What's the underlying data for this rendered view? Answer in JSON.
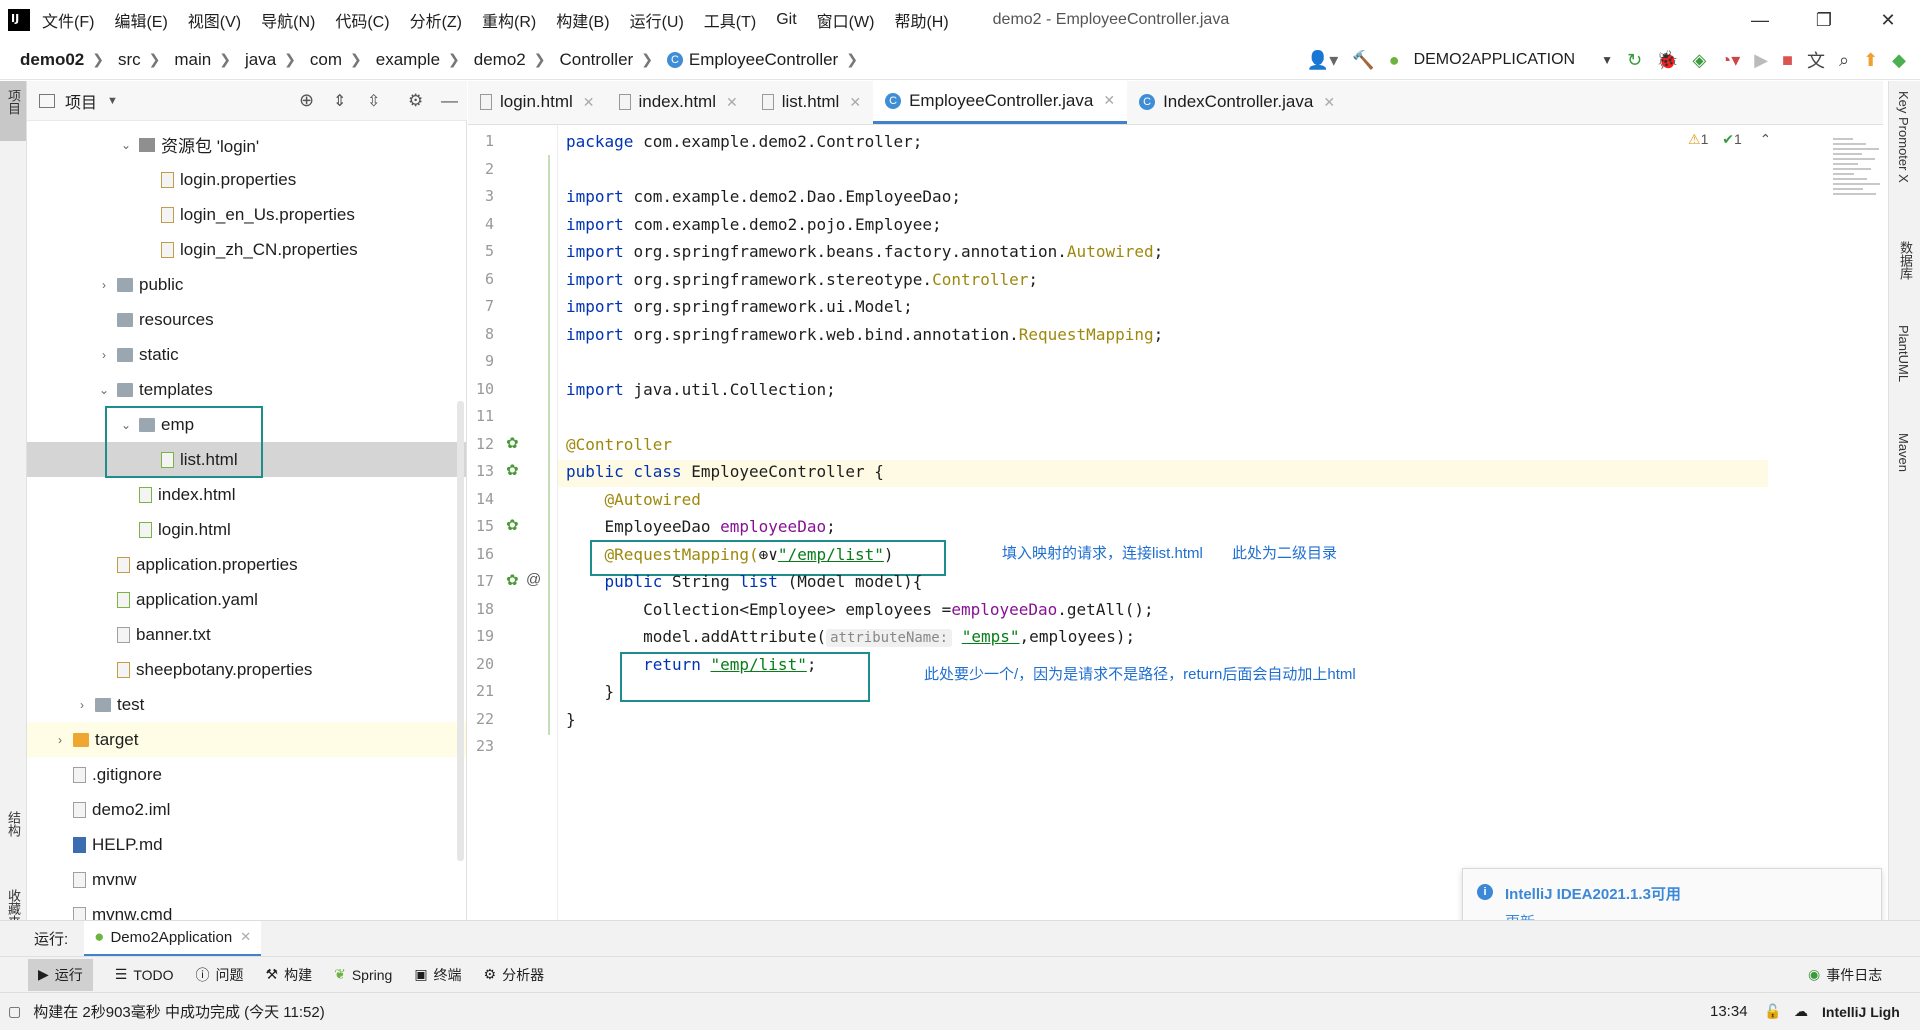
{
  "menu": {
    "items": [
      "文件(F)",
      "编辑(E)",
      "视图(V)",
      "导航(N)",
      "代码(C)",
      "分析(Z)",
      "重构(R)",
      "构建(B)",
      "运行(U)",
      "工具(T)",
      "Git",
      "窗口(W)",
      "帮助(H)"
    ],
    "window_title": "demo2 - EmployeeController.java"
  },
  "breadcrumb": [
    "demo02",
    "src",
    "main",
    "java",
    "com",
    "example",
    "demo2",
    "Controller",
    "EmployeeController"
  ],
  "run_config": "DEMO2APPLICATION",
  "project_panel": {
    "title": "项目",
    "left_tabs": [
      "项目",
      "结构",
      "收藏夹"
    ],
    "items": [
      {
        "label": "资源包 'login'",
        "depth": 2,
        "arrow": "down",
        "icon": "package"
      },
      {
        "label": "login.properties",
        "depth": 3,
        "arrow": "",
        "icon": "prop"
      },
      {
        "label": "login_en_Us.properties",
        "depth": 3,
        "arrow": "",
        "icon": "prop"
      },
      {
        "label": "login_zh_CN.properties",
        "depth": 3,
        "arrow": "",
        "icon": "prop"
      },
      {
        "label": "public",
        "depth": 1,
        "arrow": "right",
        "icon": "folder"
      },
      {
        "label": "resources",
        "depth": 1,
        "arrow": "",
        "icon": "folder"
      },
      {
        "label": "static",
        "depth": 1,
        "arrow": "right",
        "icon": "folder"
      },
      {
        "label": "templates",
        "depth": 1,
        "arrow": "down",
        "icon": "folder"
      },
      {
        "label": "emp",
        "depth": 2,
        "arrow": "down",
        "icon": "folder"
      },
      {
        "label": "list.html",
        "depth": 3,
        "arrow": "",
        "icon": "html"
      },
      {
        "label": "index.html",
        "depth": 2,
        "arrow": "",
        "icon": "html"
      },
      {
        "label": "login.html",
        "depth": 2,
        "arrow": "",
        "icon": "html"
      },
      {
        "label": "application.properties",
        "depth": 1,
        "arrow": "",
        "icon": "prop"
      },
      {
        "label": "application.yaml",
        "depth": 1,
        "arrow": "",
        "icon": "yaml"
      },
      {
        "label": "banner.txt",
        "depth": 1,
        "arrow": "",
        "icon": "txt"
      },
      {
        "label": "sheepbotany.properties",
        "depth": 1,
        "arrow": "",
        "icon": "prop"
      },
      {
        "label": "test",
        "depth": 0,
        "arrow": "right",
        "icon": "folder"
      },
      {
        "label": "target",
        "depth": -1,
        "arrow": "right",
        "icon": "folder-orange"
      },
      {
        "label": ".gitignore",
        "depth": -1,
        "arrow": "",
        "icon": "txt"
      },
      {
        "label": "demo2.iml",
        "depth": -1,
        "arrow": "",
        "icon": "txt"
      },
      {
        "label": "HELP.md",
        "depth": -1,
        "arrow": "",
        "icon": "md"
      },
      {
        "label": "mvnw",
        "depth": -1,
        "arrow": "",
        "icon": "txt"
      },
      {
        "label": "mvnw.cmd",
        "depth": -1,
        "arrow": "",
        "icon": "txt"
      }
    ]
  },
  "editor_tabs": [
    {
      "label": "login.html",
      "type": "html",
      "active": false
    },
    {
      "label": "index.html",
      "type": "html",
      "active": false
    },
    {
      "label": "list.html",
      "type": "html",
      "active": false
    },
    {
      "label": "EmployeeController.java",
      "type": "java",
      "active": true
    },
    {
      "label": "IndexController.java",
      "type": "java",
      "active": false
    }
  ],
  "inspection": {
    "warnings": "1",
    "ok": "1"
  },
  "code_lines": [
    [
      [
        "kw",
        "package"
      ],
      [
        "",
        "com.example.demo2.Controller;"
      ]
    ],
    [],
    [
      [
        "kw",
        "import"
      ],
      [
        "",
        "com.example.demo2.Dao.EmployeeDao;"
      ]
    ],
    [
      [
        "kw",
        "import"
      ],
      [
        "",
        "com.example.demo2.pojo.Employee;"
      ]
    ],
    [
      [
        "kw",
        "import"
      ],
      [
        "",
        "org.springframework.beans.factory.annotation."
      ],
      [
        "ann",
        "Autowired"
      ],
      [
        "",
        ";"
      ]
    ],
    [
      [
        "kw",
        "import"
      ],
      [
        "",
        "org.springframework.stereotype."
      ],
      [
        "ann",
        "Controller"
      ],
      [
        "",
        ";"
      ]
    ],
    [
      [
        "kw",
        "import"
      ],
      [
        "",
        "org.springframework.ui.Model;"
      ]
    ],
    [
      [
        "kw",
        "import"
      ],
      [
        "",
        "org.springframework.web.bind.annotation."
      ],
      [
        "ann",
        "RequestMapping"
      ],
      [
        "",
        ";"
      ]
    ],
    [],
    [
      [
        "kw",
        "import"
      ],
      [
        "",
        "java.util.Collection;"
      ]
    ],
    [],
    [
      [
        "ann",
        "@Controller"
      ]
    ],
    [
      [
        "kw",
        "public class"
      ],
      [
        "",
        "EmployeeController {"
      ]
    ],
    [
      [
        "ann",
        "    @Autowired"
      ]
    ],
    [
      [
        "",
        "    EmployeeDao "
      ],
      [
        "fld",
        "employeeDao"
      ],
      [
        "",
        ";"
      ]
    ],
    [
      [
        "ann",
        "    @RequestMapping("
      ],
      [
        "",
        "⊕∨"
      ],
      [
        "str",
        "\"/emp/list\""
      ],
      [
        "",
        ")"
      ]
    ],
    [
      [
        "kw",
        "    public"
      ],
      [
        "",
        "String "
      ],
      [
        "kw",
        "list"
      ],
      [
        "",
        "(Model model){"
      ]
    ],
    [
      [
        "",
        "        Collection<Employee> employees ="
      ],
      [
        "fld",
        "employeeDao"
      ],
      [
        "",
        ".getAll();"
      ]
    ],
    [
      [
        "",
        "        model.addAttribute("
      ],
      [
        "hint",
        "attributeName:"
      ],
      [
        "str",
        "\"emps\""
      ],
      [
        "",
        ",employees);"
      ]
    ],
    [
      [
        "kw",
        "        return"
      ],
      [
        "str",
        "\"emp/list\""
      ],
      [
        "",
        ";"
      ]
    ],
    [
      [
        "",
        "    }"
      ]
    ],
    [
      [
        "",
        "}"
      ]
    ],
    []
  ],
  "notes": {
    "note1": "填入映射的请求，连接list.html",
    "note2": "此处为二级目录",
    "note3": "此处要少一个/，因为是请求不是路径，return后面会自动加上html"
  },
  "right_tabs": [
    "Key Promoter X",
    "数据库",
    "PlantUML",
    "Maven"
  ],
  "notification": {
    "title": "IntelliJ IDEA2021.1.3可用",
    "action": "更新..."
  },
  "run_bar": {
    "label": "运行:",
    "app": "Demo2Application"
  },
  "bottom_tools": [
    "运行",
    "TODO",
    "问题",
    "构建",
    "Spring",
    "终端",
    "分析器"
  ],
  "event_log": "事件日志",
  "status": {
    "message": "构建在 2秒903毫秒 中成功完成 (今天 11:52)",
    "time": "13:34",
    "theme": "IntelliJ Ligh"
  }
}
